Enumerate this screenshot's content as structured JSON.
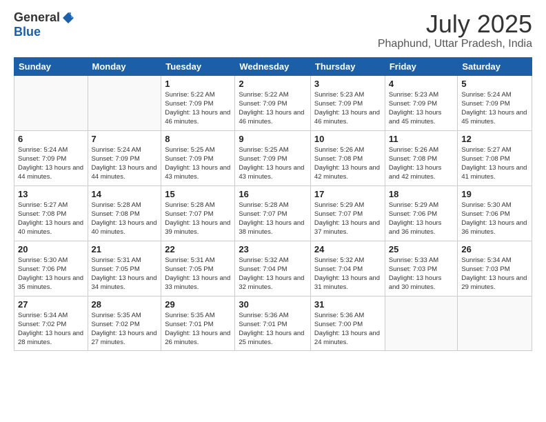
{
  "logo": {
    "general": "General",
    "blue": "Blue"
  },
  "header": {
    "month": "July 2025",
    "location": "Phaphund, Uttar Pradesh, India"
  },
  "weekdays": [
    "Sunday",
    "Monday",
    "Tuesday",
    "Wednesday",
    "Thursday",
    "Friday",
    "Saturday"
  ],
  "weeks": [
    [
      {
        "day": "",
        "info": ""
      },
      {
        "day": "",
        "info": ""
      },
      {
        "day": "1",
        "info": "Sunrise: 5:22 AM\nSunset: 7:09 PM\nDaylight: 13 hours and 46 minutes."
      },
      {
        "day": "2",
        "info": "Sunrise: 5:22 AM\nSunset: 7:09 PM\nDaylight: 13 hours and 46 minutes."
      },
      {
        "day": "3",
        "info": "Sunrise: 5:23 AM\nSunset: 7:09 PM\nDaylight: 13 hours and 46 minutes."
      },
      {
        "day": "4",
        "info": "Sunrise: 5:23 AM\nSunset: 7:09 PM\nDaylight: 13 hours and 45 minutes."
      },
      {
        "day": "5",
        "info": "Sunrise: 5:24 AM\nSunset: 7:09 PM\nDaylight: 13 hours and 45 minutes."
      }
    ],
    [
      {
        "day": "6",
        "info": "Sunrise: 5:24 AM\nSunset: 7:09 PM\nDaylight: 13 hours and 44 minutes."
      },
      {
        "day": "7",
        "info": "Sunrise: 5:24 AM\nSunset: 7:09 PM\nDaylight: 13 hours and 44 minutes."
      },
      {
        "day": "8",
        "info": "Sunrise: 5:25 AM\nSunset: 7:09 PM\nDaylight: 13 hours and 43 minutes."
      },
      {
        "day": "9",
        "info": "Sunrise: 5:25 AM\nSunset: 7:09 PM\nDaylight: 13 hours and 43 minutes."
      },
      {
        "day": "10",
        "info": "Sunrise: 5:26 AM\nSunset: 7:08 PM\nDaylight: 13 hours and 42 minutes."
      },
      {
        "day": "11",
        "info": "Sunrise: 5:26 AM\nSunset: 7:08 PM\nDaylight: 13 hours and 42 minutes."
      },
      {
        "day": "12",
        "info": "Sunrise: 5:27 AM\nSunset: 7:08 PM\nDaylight: 13 hours and 41 minutes."
      }
    ],
    [
      {
        "day": "13",
        "info": "Sunrise: 5:27 AM\nSunset: 7:08 PM\nDaylight: 13 hours and 40 minutes."
      },
      {
        "day": "14",
        "info": "Sunrise: 5:28 AM\nSunset: 7:08 PM\nDaylight: 13 hours and 40 minutes."
      },
      {
        "day": "15",
        "info": "Sunrise: 5:28 AM\nSunset: 7:07 PM\nDaylight: 13 hours and 39 minutes."
      },
      {
        "day": "16",
        "info": "Sunrise: 5:28 AM\nSunset: 7:07 PM\nDaylight: 13 hours and 38 minutes."
      },
      {
        "day": "17",
        "info": "Sunrise: 5:29 AM\nSunset: 7:07 PM\nDaylight: 13 hours and 37 minutes."
      },
      {
        "day": "18",
        "info": "Sunrise: 5:29 AM\nSunset: 7:06 PM\nDaylight: 13 hours and 36 minutes."
      },
      {
        "day": "19",
        "info": "Sunrise: 5:30 AM\nSunset: 7:06 PM\nDaylight: 13 hours and 36 minutes."
      }
    ],
    [
      {
        "day": "20",
        "info": "Sunrise: 5:30 AM\nSunset: 7:06 PM\nDaylight: 13 hours and 35 minutes."
      },
      {
        "day": "21",
        "info": "Sunrise: 5:31 AM\nSunset: 7:05 PM\nDaylight: 13 hours and 34 minutes."
      },
      {
        "day": "22",
        "info": "Sunrise: 5:31 AM\nSunset: 7:05 PM\nDaylight: 13 hours and 33 minutes."
      },
      {
        "day": "23",
        "info": "Sunrise: 5:32 AM\nSunset: 7:04 PM\nDaylight: 13 hours and 32 minutes."
      },
      {
        "day": "24",
        "info": "Sunrise: 5:32 AM\nSunset: 7:04 PM\nDaylight: 13 hours and 31 minutes."
      },
      {
        "day": "25",
        "info": "Sunrise: 5:33 AM\nSunset: 7:03 PM\nDaylight: 13 hours and 30 minutes."
      },
      {
        "day": "26",
        "info": "Sunrise: 5:34 AM\nSunset: 7:03 PM\nDaylight: 13 hours and 29 minutes."
      }
    ],
    [
      {
        "day": "27",
        "info": "Sunrise: 5:34 AM\nSunset: 7:02 PM\nDaylight: 13 hours and 28 minutes."
      },
      {
        "day": "28",
        "info": "Sunrise: 5:35 AM\nSunset: 7:02 PM\nDaylight: 13 hours and 27 minutes."
      },
      {
        "day": "29",
        "info": "Sunrise: 5:35 AM\nSunset: 7:01 PM\nDaylight: 13 hours and 26 minutes."
      },
      {
        "day": "30",
        "info": "Sunrise: 5:36 AM\nSunset: 7:01 PM\nDaylight: 13 hours and 25 minutes."
      },
      {
        "day": "31",
        "info": "Sunrise: 5:36 AM\nSunset: 7:00 PM\nDaylight: 13 hours and 24 minutes."
      },
      {
        "day": "",
        "info": ""
      },
      {
        "day": "",
        "info": ""
      }
    ]
  ]
}
